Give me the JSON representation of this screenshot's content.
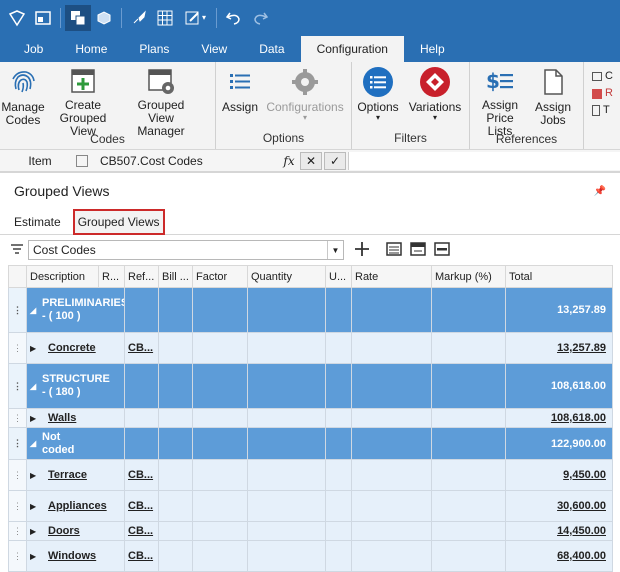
{
  "qat": {
    "icons": [
      "app-icon",
      "layout-icon",
      "copy-icon",
      "cubes-icon",
      "rocket-icon",
      "grid-icon",
      "edit-icon",
      "undo-icon",
      "redo-icon"
    ]
  },
  "tabs": [
    "Job",
    "Home",
    "Plans",
    "View",
    "Data",
    "Configuration",
    "Help"
  ],
  "active_tab": "Configuration",
  "ribbon": {
    "groups": [
      {
        "label": "Codes",
        "buttons": [
          "Manage Codes",
          "Create Grouped View",
          "Grouped View Manager"
        ]
      },
      {
        "label": "Options",
        "buttons": [
          "Assign",
          "Configurations"
        ]
      },
      {
        "label": "Filters",
        "buttons": [
          "Options",
          "Variations"
        ]
      },
      {
        "label": "References",
        "buttons": [
          "Assign Price Lists",
          "Assign Jobs"
        ]
      }
    ],
    "more_items": [
      "C",
      "R",
      "T"
    ]
  },
  "formula_bar": {
    "item_label": "Item",
    "cell": "CB507.Cost Codes",
    "fx": "fx"
  },
  "panel": {
    "title": "Grouped Views",
    "subtabs": [
      "Estimate",
      "Grouped Views"
    ],
    "active_subtab": "Grouped Views",
    "combo_value": "Cost Codes"
  },
  "grid": {
    "columns": [
      "Description",
      "R...",
      "Ref...",
      "Bill ...",
      "Factor",
      "Quantity",
      "U...",
      "Rate",
      "Markup (%)",
      "Total"
    ],
    "rows": [
      {
        "type": "group",
        "desc": "PRELIMINARIES - ( 100 )",
        "ref": "",
        "total": "13,257.89"
      },
      {
        "type": "detail",
        "desc": "Concrete",
        "ref": "CB...",
        "total": "13,257.89"
      },
      {
        "type": "group",
        "desc": "STRUCTURE - ( 180 )",
        "ref": "",
        "total": "108,618.00"
      },
      {
        "type": "detail",
        "desc": "Walls",
        "ref": "",
        "total": "108,618.00"
      },
      {
        "type": "group",
        "desc": "Not coded",
        "ref": "",
        "total": "122,900.00"
      },
      {
        "type": "detail",
        "desc": "Terrace",
        "ref": "CB...",
        "total": "9,450.00"
      },
      {
        "type": "detail",
        "desc": "Appliances",
        "ref": "CB...",
        "total": "30,600.00"
      },
      {
        "type": "detail",
        "desc": "Doors",
        "ref": "CB...",
        "total": "14,450.00"
      },
      {
        "type": "detail",
        "desc": "Windows",
        "ref": "CB...",
        "total": "68,400.00"
      }
    ]
  },
  "colors": {
    "title_bar": "#2a6fb3",
    "group_row": "#5d9cd8",
    "detail_row": "#e6f0fa",
    "highlight": "#cc2a2a"
  }
}
